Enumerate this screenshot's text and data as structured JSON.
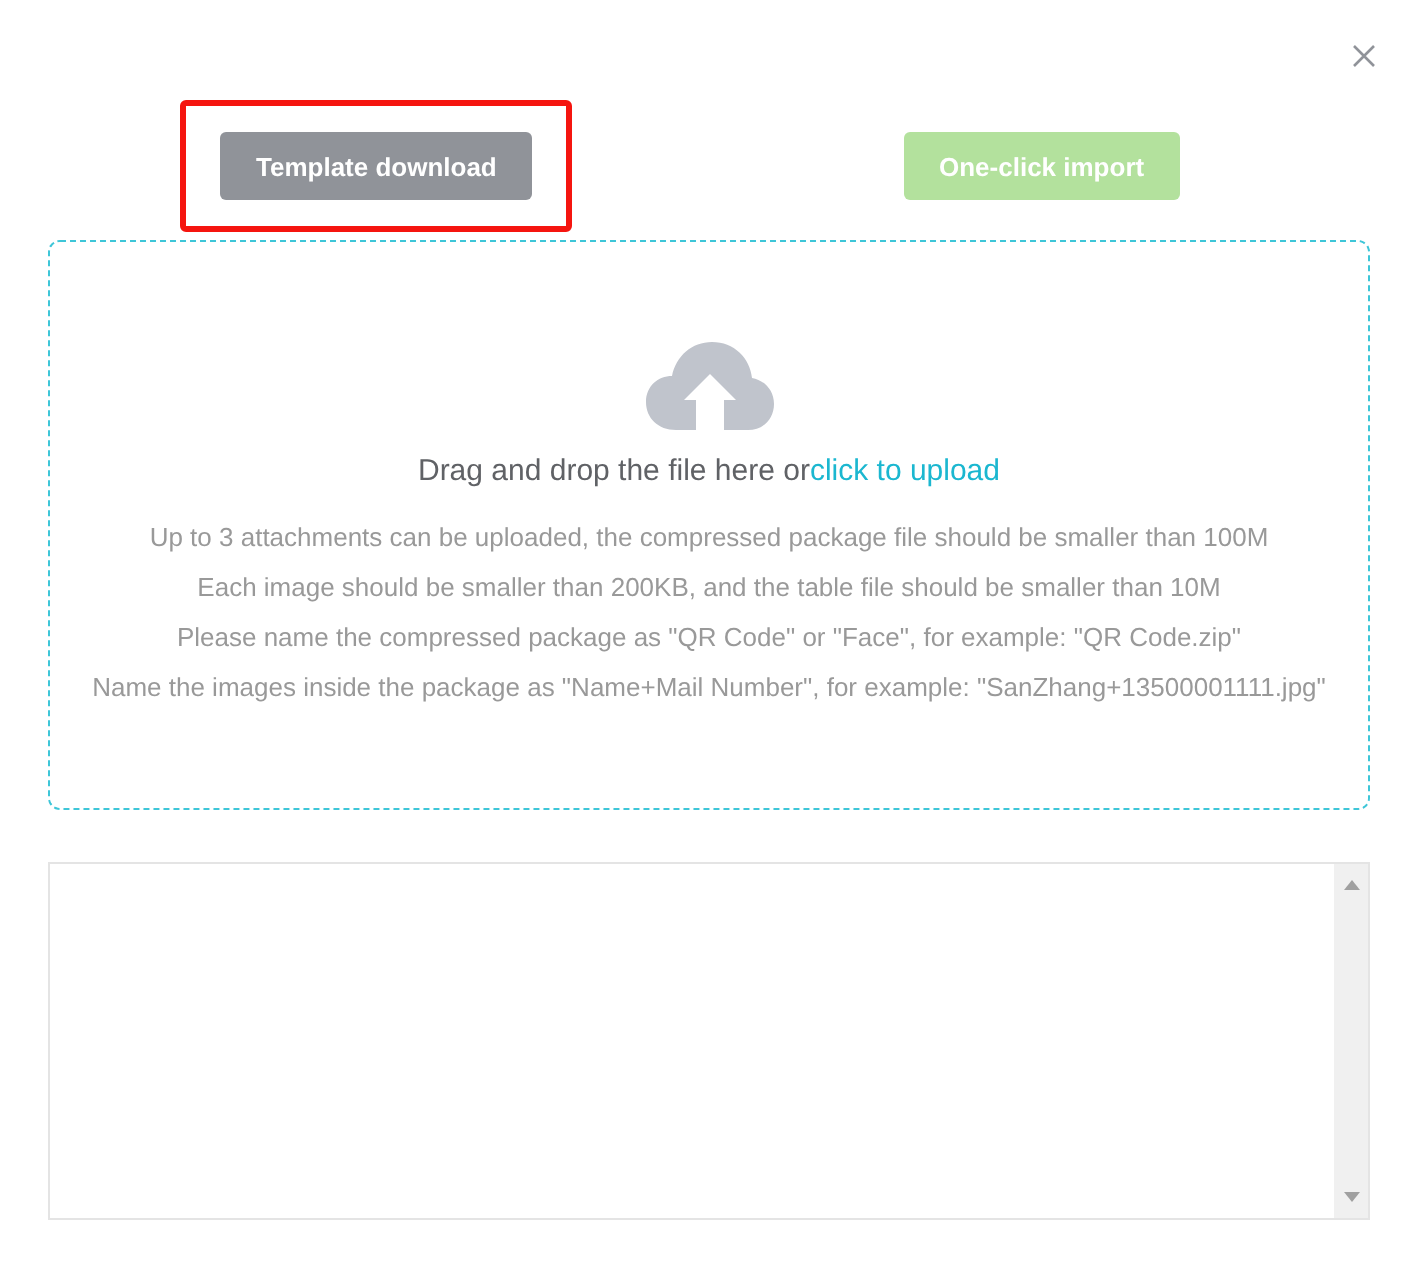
{
  "actions": [
    {
      "label": "Template download",
      "kind": "template",
      "highlighted": true,
      "disabled": false
    },
    {
      "label": "One-click import",
      "kind": "import",
      "highlighted": false,
      "disabled": true
    }
  ],
  "upload": {
    "prompt": "Drag and drop the file here or",
    "link": "click to upload",
    "notes": [
      "Up to 3 attachments can be uploaded, the compressed package file should be smaller than 100M",
      "Each image should be smaller than 200KB, and the table file should be smaller than 10M",
      "Please name the compressed package as \"QR Code\" or \"Face\", for example: \"QR Code.zip\"",
      "Name the images inside the package as \"Name+Mail Number\", for example: \"SanZhang+13500001111.jpg\""
    ]
  }
}
